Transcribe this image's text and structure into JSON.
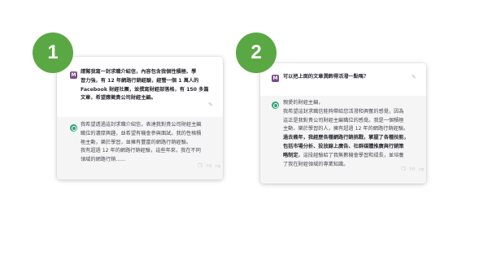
{
  "panel1": {
    "number": "1",
    "user_avatar": "M",
    "user_lines": [
      "請幫我寫一封求職介紹信，內容包含我個性積極、學",
      "習力強，有 12 年網路行銷經驗，經營一個 1 萬人的",
      "Facebook 財經社團，並撰寫財經部落格，有 150 多篇",
      "文章，希望應徵貴公司財經主編。"
    ],
    "bot_lines": [
      "我希望透過這封求職介紹信，表達我對貴公司財經主編",
      "職位的濃厚興趣，並希望有機會參與面試。我的性格積",
      "極主動，樂於學習，並擁有豐富的網路行銷經驗。",
      "我有超過 12 年的網路行銷經驗，這些年來，我在不同",
      "領域的網路行銷......"
    ]
  },
  "panel2": {
    "number": "2",
    "user_avatar": "M",
    "user_line": "可以把上面的文章潤飾得活潑一點嗎？",
    "bot_lines": [
      {
        "pre": "親愛的財經主編，",
        "bold": "",
        "post": ""
      },
      {
        "pre": "我希望這封求職信能夠帶給您活潑和興奮的感覺，因為",
        "bold": "",
        "post": ""
      },
      {
        "pre": "這正是我對貴公司財經主編職位的感覺。我是一個積極",
        "bold": "",
        "post": ""
      },
      {
        "pre": "主動、樂於學習的人，擁有超過 12 年的網路行銷經驗。",
        "bold": "",
        "post": ""
      },
      {
        "pre": "",
        "bold": "過去幾年，我經歷各種網路行銷挑戰，掌握了各種技能，",
        "post": ""
      },
      {
        "pre": "",
        "bold": "包括市場分析、投放線上廣告、社群媒體推廣與行銷策",
        "post": ""
      },
      {
        "pre": "",
        "bold": "略制定",
        "post": "。這段經驗給了我無數機會學習和成長，並培養"
      },
      {
        "pre": "了我在財經領域的專業知識。",
        "bold": "",
        "post": ""
      }
    ]
  },
  "icons": {
    "edit": "edit-icon",
    "copy": "copy-icon",
    "thumb_up": "thumbs-up-icon",
    "thumb_down": "thumbs-down-icon"
  },
  "colors": {
    "badge": "#5aa844",
    "user_avatar": "#7a4b8c",
    "bot_avatar": "#2fa37a",
    "bot_bg": "#f5f5f6"
  }
}
